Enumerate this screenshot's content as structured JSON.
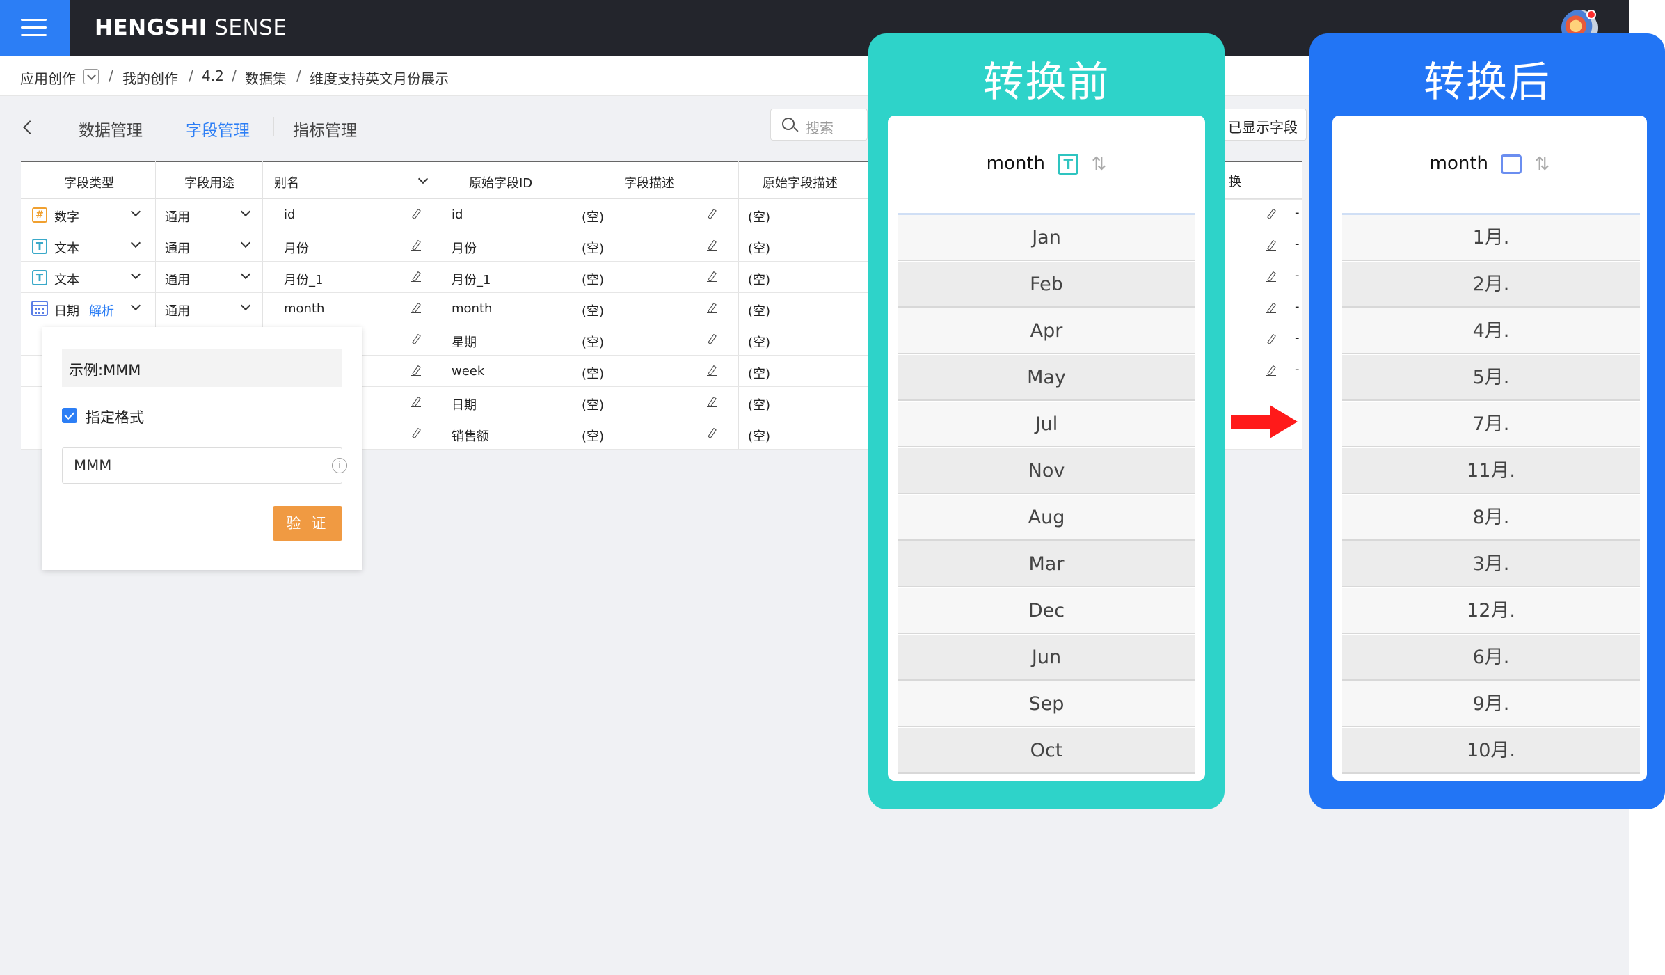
{
  "app": {
    "brand_bold": "HENGSHI",
    "brand_rest": " SENSE"
  },
  "breadcrumb": {
    "root": "应用创作",
    "items": [
      "我的创作",
      "4.2",
      "数据集",
      "维度支持英文月份展示"
    ],
    "sep": "/"
  },
  "tabs": {
    "back": "<",
    "items": [
      "数据管理",
      "字段管理",
      "指标管理"
    ],
    "active": "字段管理"
  },
  "search": {
    "placeholder": "搜索"
  },
  "shown_fields_button": "已显示字段",
  "table": {
    "headers": [
      "字段类型",
      "字段用途",
      "别名",
      "原始字段ID",
      "字段描述",
      "原始字段描述"
    ],
    "rows": [
      {
        "type": "数字",
        "usage": "通用",
        "alias": "id",
        "orig_id": "id",
        "desc": "(空)",
        "orig_desc": "(空)"
      },
      {
        "type": "文本",
        "usage": "通用",
        "alias": "月份",
        "orig_id": "月份",
        "desc": "(空)",
        "orig_desc": "(空)"
      },
      {
        "type": "文本",
        "usage": "通用",
        "alias": "月份_1",
        "orig_id": "月份_1",
        "desc": "(空)",
        "orig_desc": "(空)"
      },
      {
        "type": "日期",
        "parse": "解析",
        "usage": "通用",
        "alias": "month",
        "orig_id": "month",
        "desc": "(空)",
        "orig_desc": "(空)"
      },
      {
        "orig_id": "星期",
        "desc": "(空)",
        "orig_desc": "(空)"
      },
      {
        "orig_id": "week",
        "desc": "(空)",
        "orig_desc": "(空)"
      },
      {
        "orig_id": "日期",
        "desc": "(空)",
        "orig_desc": "(空)"
      },
      {
        "orig_id": "销售额",
        "desc": "(空)",
        "orig_desc": "(空)"
      }
    ],
    "right_partial_header": "换",
    "right_dash": "-"
  },
  "popup": {
    "example": "示例:MMM",
    "checkbox_label": "指定格式",
    "checkbox_checked": true,
    "format_value": "MMM",
    "validate_button": "验 证"
  },
  "before_panel": {
    "title": "转换前",
    "column": "month",
    "type_icon": "T",
    "color": "#2ed3c9",
    "values": [
      "Jan",
      "Feb",
      "Apr",
      "May",
      "Jul",
      "Nov",
      "Aug",
      "Mar",
      "Dec",
      "Jun",
      "Sep",
      "Oct"
    ]
  },
  "after_panel": {
    "title": "转换后",
    "column": "month",
    "color": "#2275f5",
    "values": [
      "1月.",
      "2月.",
      "4月.",
      "5月.",
      "7月.",
      "11月.",
      "8月.",
      "3月.",
      "12月.",
      "6月.",
      "9月.",
      "10月."
    ]
  },
  "colors": {
    "primary": "#2c7ef5",
    "topbar": "#23252c",
    "validate": "#f09a42",
    "arrow": "#ff1a1a"
  }
}
